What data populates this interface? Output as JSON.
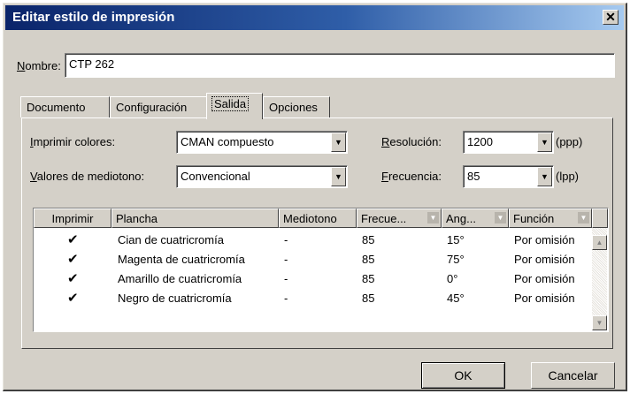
{
  "window": {
    "title": "Editar estilo de impresión",
    "close_icon": "✕"
  },
  "nombre": {
    "label": "Nombre:",
    "accel": "N",
    "label_rest": "ombre:",
    "value": "CTP 262"
  },
  "tabs": [
    {
      "label": "Documento"
    },
    {
      "label": "Configuración"
    },
    {
      "label": "Salida",
      "active": true
    },
    {
      "label": "Opciones"
    }
  ],
  "salida": {
    "imprimir_colores": {
      "accel": "I",
      "rest": "mprimir colores:",
      "value": "CMAN compuesto"
    },
    "valores_mediotono": {
      "accel": "V",
      "rest": "alores de mediotono:",
      "value": "Convencional"
    },
    "resolucion": {
      "accel": "R",
      "rest": "esolución:",
      "value": "1200",
      "unit": "(ppp)"
    },
    "frecuencia": {
      "accel": "F",
      "rest": "recuencia:",
      "value": "85",
      "unit": "(lpp)"
    }
  },
  "table": {
    "headers": [
      "Imprimir",
      "Plancha",
      "Mediotono",
      "Frecue...",
      "Ang...",
      "Función"
    ],
    "rows": [
      {
        "imprimir": "✔",
        "plancha": "Cian de cuatricromía",
        "mediotono": "-",
        "frecuencia": "85",
        "angulo": "15°",
        "funcion": "Por omisión"
      },
      {
        "imprimir": "✔",
        "plancha": "Magenta de cuatricromía",
        "mediotono": "-",
        "frecuencia": "85",
        "angulo": "75°",
        "funcion": "Por omisión"
      },
      {
        "imprimir": "✔",
        "plancha": "Amarillo de cuatricromía",
        "mediotono": "-",
        "frecuencia": "85",
        "angulo": "0°",
        "funcion": "Por omisión"
      },
      {
        "imprimir": "✔",
        "plancha": "Negro de cuatricromía",
        "mediotono": "-",
        "frecuencia": "85",
        "angulo": "45°",
        "funcion": "Por omisión"
      }
    ]
  },
  "buttons": {
    "ok": "OK",
    "cancel": "Cancelar"
  },
  "icons": {
    "dropdown": "▼",
    "scroll_up": "▲",
    "scroll_down": "▼",
    "check": "check-icon"
  },
  "colors": {
    "titlebar_start": "#0a246a",
    "titlebar_end": "#a6caf0",
    "face": "#d4d0c8"
  }
}
